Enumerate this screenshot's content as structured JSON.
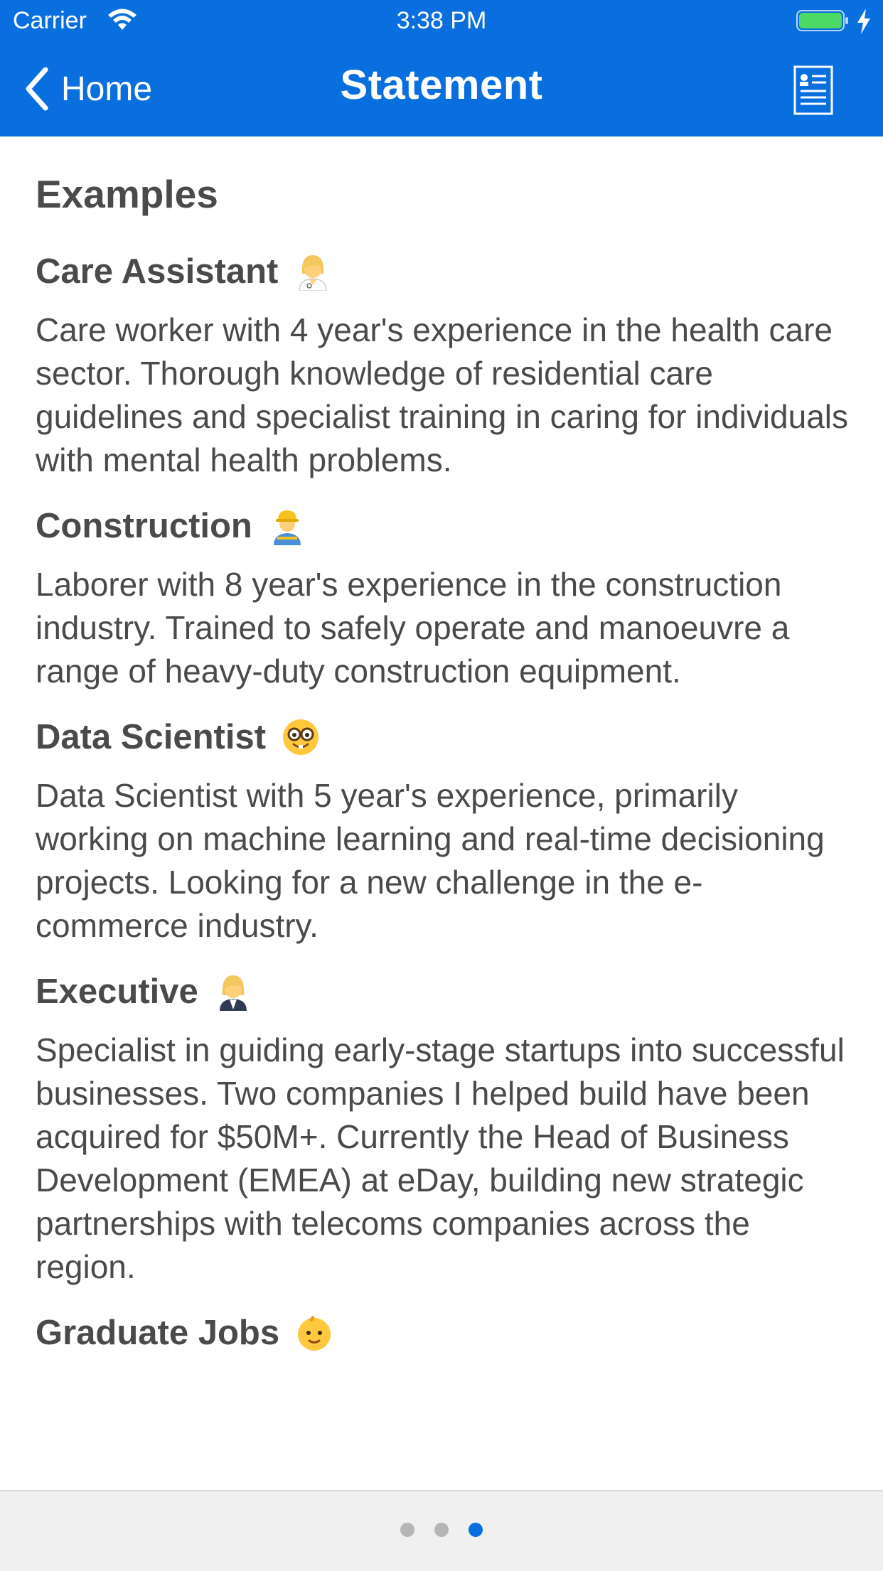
{
  "status_bar": {
    "carrier": "Carrier",
    "time": "3:38 PM"
  },
  "nav": {
    "back_label": "Home",
    "title": "Statement",
    "action_icon": "document-list-icon"
  },
  "content": {
    "heading": "Examples",
    "examples": [
      {
        "title": "Care Assistant",
        "emoji": "health-worker-woman-icon",
        "body": "Care worker with 4 year's experience in the health care sector. Thorough knowledge of residential care guidelines and specialist training in caring for individuals with mental health problems."
      },
      {
        "title": "Construction",
        "emoji": "construction-worker-woman-icon",
        "body": "Laborer with 8 year's experience in the construction industry. Trained to safely operate and manoeuvre a range of heavy-duty construction equipment."
      },
      {
        "title": "Data Scientist",
        "emoji": "nerd-face-icon",
        "body": "Data Scientist with 5 year's experience, primarily working on machine learning and real-time decisioning projects. Looking for a new challenge in the e-commerce industry."
      },
      {
        "title": "Executive",
        "emoji": "office-worker-woman-icon",
        "body": "Specialist in guiding early-stage startups into successful businesses. Two companies I helped build have been acquired for $50M+. Currently the Head of Business Development (EMEA) at eDay, building new strategic partnerships with telecoms companies across the region."
      },
      {
        "title": "Graduate Jobs",
        "emoji": "baby-icon",
        "body": ""
      }
    ]
  },
  "pager": {
    "count": 3,
    "active_index": 2
  },
  "colors": {
    "accent": "#0a6fde",
    "text": "#4a4a4a",
    "battery": "#4cd964",
    "dot_inactive": "#b5b5b5",
    "bar_bg": "#f0f0f0"
  }
}
